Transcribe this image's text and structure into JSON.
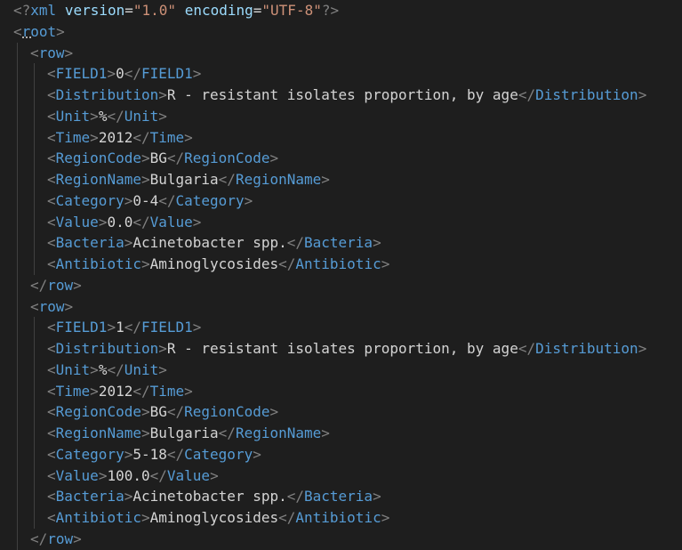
{
  "document": {
    "xml_decl": {
      "open": "<?",
      "name": "xml",
      "version_attr": "version",
      "version_value": "\"1.0\"",
      "encoding_attr": "encoding",
      "encoding_value": "\"UTF-8\"",
      "close": "?>"
    },
    "root_tag": "root",
    "row_tag": "row",
    "rows": [
      {
        "fields": [
          {
            "tag": "FIELD1",
            "value": "0"
          },
          {
            "tag": "Distribution",
            "value": "R - resistant isolates proportion, by age"
          },
          {
            "tag": "Unit",
            "value": "%"
          },
          {
            "tag": "Time",
            "value": "2012"
          },
          {
            "tag": "RegionCode",
            "value": "BG"
          },
          {
            "tag": "RegionName",
            "value": "Bulgaria"
          },
          {
            "tag": "Category",
            "value": "0-4"
          },
          {
            "tag": "Value",
            "value": "0.0"
          },
          {
            "tag": "Bacteria",
            "value": "Acinetobacter spp."
          },
          {
            "tag": "Antibiotic",
            "value": "Aminoglycosides"
          }
        ]
      },
      {
        "fields": [
          {
            "tag": "FIELD1",
            "value": "1"
          },
          {
            "tag": "Distribution",
            "value": "R - resistant isolates proportion, by age"
          },
          {
            "tag": "Unit",
            "value": "%"
          },
          {
            "tag": "Time",
            "value": "2012"
          },
          {
            "tag": "RegionCode",
            "value": "BG"
          },
          {
            "tag": "RegionName",
            "value": "Bulgaria"
          },
          {
            "tag": "Category",
            "value": "5-18"
          },
          {
            "tag": "Value",
            "value": "100.0"
          },
          {
            "tag": "Bacteria",
            "value": "Acinetobacter spp."
          },
          {
            "tag": "Antibiotic",
            "value": "Aminoglycosides"
          }
        ]
      }
    ]
  },
  "colors": {
    "background": "#1e1e1e",
    "punctuation": "#808080",
    "tag": "#569cd6",
    "attribute": "#9cdcfe",
    "string": "#ce9178",
    "text": "#d4d4d4"
  }
}
